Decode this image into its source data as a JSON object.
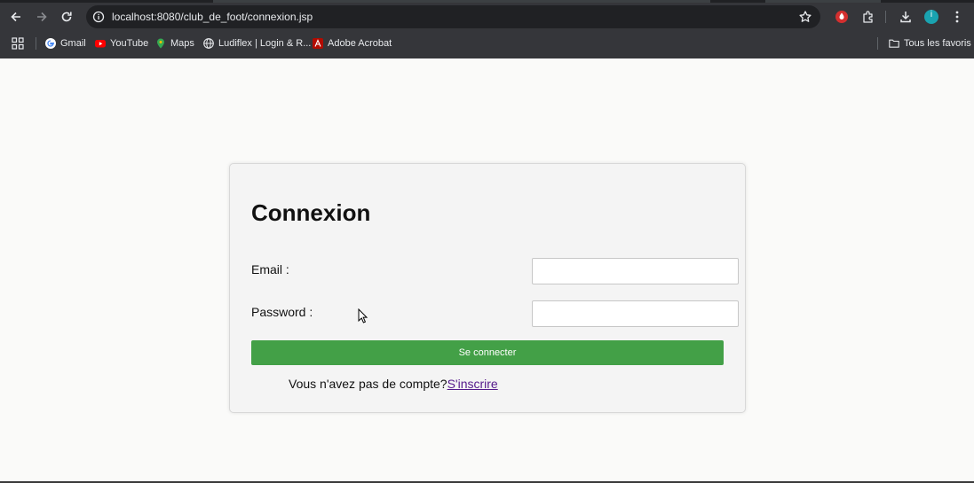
{
  "browser": {
    "url": "localhost:8080/club_de_foot/connexion.jsp",
    "profile_initial": "i",
    "bookmarks": [
      {
        "label": "Gmail",
        "icon": "google-icon"
      },
      {
        "label": "YouTube",
        "icon": "youtube-icon"
      },
      {
        "label": "Maps",
        "icon": "maps-icon"
      },
      {
        "label": "Ludiflex | Login & R...",
        "icon": "globe-icon"
      },
      {
        "label": "Adobe Acrobat",
        "icon": "acrobat-icon"
      }
    ],
    "all_bookmarks_label": "Tous les favoris"
  },
  "login": {
    "title": "Connexion",
    "email_label": "Email :",
    "email_value": "",
    "password_label": "Password :",
    "password_value": "",
    "submit_label": "Se connecter",
    "signup_prompt": "Vous n'avez pas de compte?",
    "signup_link": "S'inscrire"
  },
  "colors": {
    "chrome_bg": "#35363a",
    "submit_bg": "#43a047",
    "link": "#551a8b",
    "profile_avatar": "#1aa3b0"
  }
}
